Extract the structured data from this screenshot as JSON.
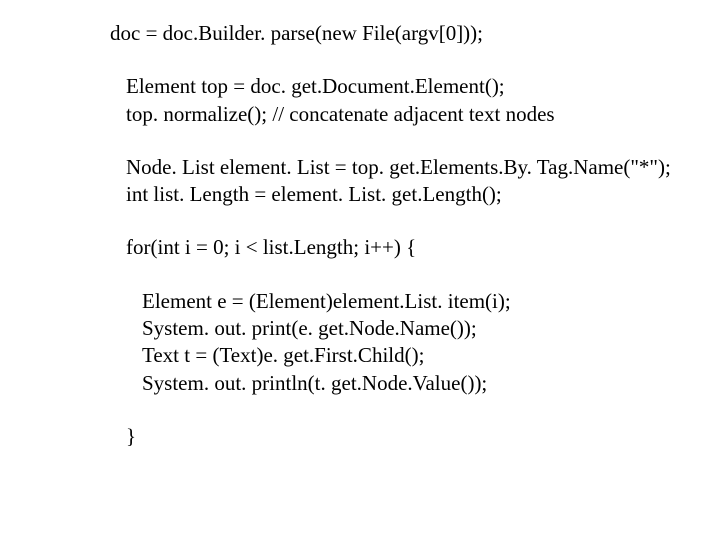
{
  "code": {
    "l1": "doc = doc.Builder. parse(new File(argv[0]));",
    "l2": "Element top = doc. get.Document.Element();",
    "l3": "top. normalize();      // concatenate adjacent text nodes",
    "l4": "Node. List element. List = top. get.Elements.By. Tag.Name(\"*\");",
    "l5": "int list. Length = element. List. get.Length();",
    "l6": "for(int i = 0; i < list.Length; i++) {",
    "l7": "Element e = (Element)element.List. item(i);",
    "l8": "System. out. print(e. get.Node.Name());",
    "l9": "Text t = (Text)e. get.First.Child();",
    "l10": "System. out. println(t. get.Node.Value());",
    "l11": "}"
  }
}
